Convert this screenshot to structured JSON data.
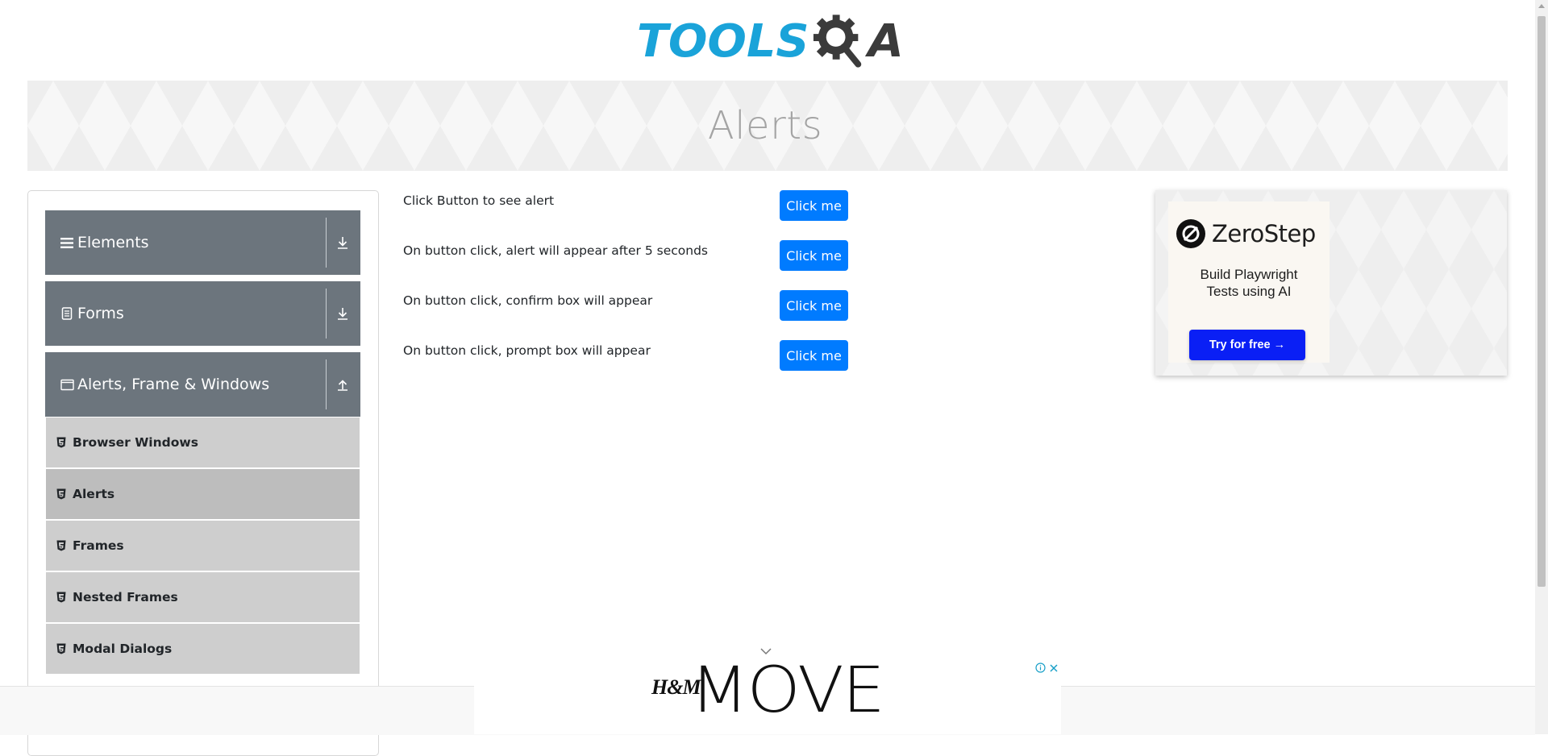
{
  "header": {
    "logo_text_tools": "TOOLS",
    "logo_text_a": "A",
    "brand_colors": {
      "tools": "#1aa3d9",
      "gear": "#3b3b3b"
    }
  },
  "banner": {
    "title": "Alerts"
  },
  "sidebar": {
    "groups": [
      {
        "label": "Elements",
        "icon": "hamburger-icon",
        "arrow": "download-arrow-icon",
        "expanded": false
      },
      {
        "label": "Forms",
        "icon": "document-icon",
        "arrow": "download-arrow-icon",
        "expanded": false
      },
      {
        "label": "Alerts, Frame & Windows",
        "icon": "window-icon",
        "arrow": "upload-arrow-icon",
        "expanded": true
      }
    ],
    "items": [
      {
        "label": "Browser Windows",
        "active": false
      },
      {
        "label": "Alerts",
        "active": true
      },
      {
        "label": "Frames",
        "active": false
      },
      {
        "label": "Nested Frames",
        "active": false
      },
      {
        "label": "Modal Dialogs",
        "active": false
      }
    ]
  },
  "main": {
    "rows": [
      {
        "label": "Click Button to see alert",
        "button": "Click me"
      },
      {
        "label": "On button click, alert will appear after 5 seconds",
        "button": "Click me"
      },
      {
        "label": "On button click, confirm box will appear",
        "button": "Click me"
      },
      {
        "label": "On button click, prompt box will appear",
        "button": "Click me"
      }
    ],
    "button_color": "#007bff"
  },
  "ad_right": {
    "brand": "ZeroStep",
    "tagline_line1": "Build Playwright",
    "tagline_line2": "Tests using AI",
    "cta": "Try for free →",
    "cta_color": "#0a1ff5"
  },
  "ad_bottom": {
    "brand": "H&M",
    "headline": "MOVE"
  }
}
